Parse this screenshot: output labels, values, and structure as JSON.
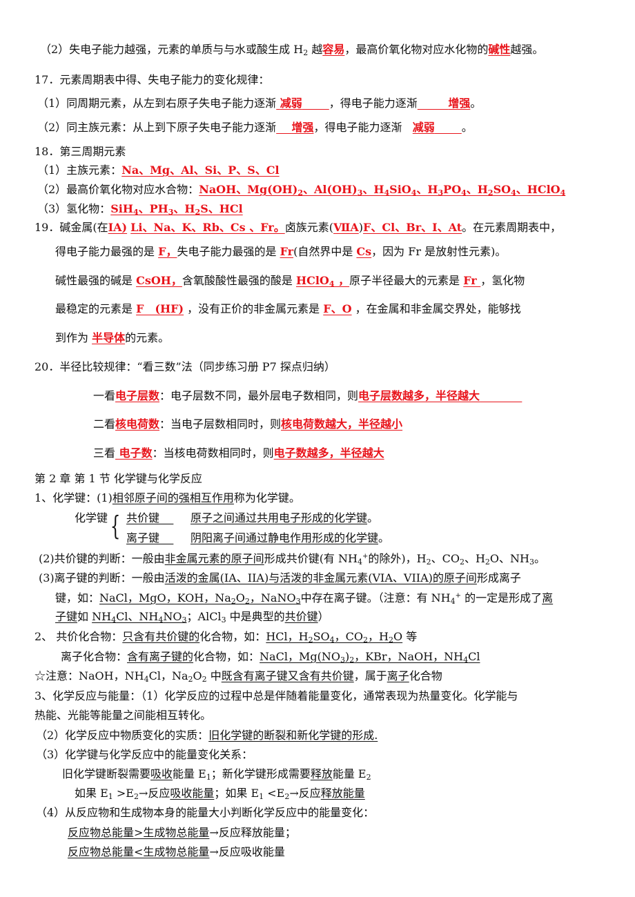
{
  "doc": {
    "l1": {
      "a": "（2）失电子能力越强，元素的单质与与水或酸生成 H",
      "sub": "2",
      "b": " 越",
      "r1": "容易",
      "c": "，最高价氧化物对应水化物的",
      "r2": "碱性",
      "d": "越强。"
    },
    "l2": "17．元素周期表中得、失电子能力的变化规律：",
    "l3": {
      "a": "（1）同周期元素，从左到右原子失电子能力逐渐",
      "r1": "减弱",
      "b": "，得电子能力逐渐",
      "r2": "增强",
      "c": "。"
    },
    "l4": {
      "a": "（2）同主族元素：从上到下原子失电子能力逐渐",
      "r1": "增强",
      "b": "，得电子能力逐渐",
      "r2": "减弱",
      "c": "。"
    },
    "l5": "18．第三周期元素",
    "l6": {
      "a": "（1）主族元素：",
      "r": "Na、Mg、Al、Si、P、S、Cl"
    },
    "l7": {
      "a": "（2）最高价氧化物对应水合物：",
      "parts": [
        "NaOH、Mg(OH)",
        "2",
        "、Al(OH)",
        "3",
        "、H",
        "4",
        "SiO",
        "4",
        "、H",
        "3",
        "PO",
        "4",
        "、H",
        "2",
        "SO",
        "4",
        "、HClO",
        "4"
      ]
    },
    "l8": {
      "a": "（3）氢化物：",
      "parts": [
        "SiH",
        "4",
        "、PH",
        "3",
        "、H",
        "2",
        "S、HCl"
      ]
    },
    "l9": {
      "a": "19．碱金属(在",
      "r1": "ⅠA)",
      "r2": "Li、Na、K、Rb、Cs 、Fr。",
      "b": "卤族元素(",
      "r3": "ⅦA",
      "c": ")",
      "r4": "F、Cl、Br、I、At",
      "d": "。在元素周期表中，"
    },
    "l10": {
      "a": "得电子能力最强的是 ",
      "r1": "F，",
      "b": "失电子能力最强的是 ",
      "r2": "Fr",
      "c": "(自然界中是 ",
      "r3": "Cs",
      "d": "，因为 Fr 是放射性元素)。"
    },
    "l11": {
      "a": "碱性最强的碱是 ",
      "r1": "CsOH，",
      "b": "含氧酸酸性最强的酸是 ",
      "r2": "HClO",
      "r2sub": "4",
      "r2b": " ，",
      "c": "原子半径最大的元素是 ",
      "r3": "Fr ",
      "d": "，氢化物"
    },
    "l12": {
      "a": "最稳定的元素是 ",
      "r1": "F　(HF)",
      "b": " ，没有正价的非金属元素是 ",
      "r2": "F、O",
      "c": " ，在金属和非金属交界处，能够找"
    },
    "l13": {
      "a": "到作为 ",
      "r1": "半导体",
      "b": "的元素。"
    },
    "l14": "20．半径比较规律：“看三数”法（同步练习册 P7  探点归纳）",
    "l15": {
      "a": "一看",
      "r1": "电子层数",
      "b": "：电子层数不同，最外层电子数相同，则",
      "r2": "电子层数越多，半径越大"
    },
    "l16": {
      "a": "二看",
      "r1": "核电荷数",
      "b": "：当电子层数相同时，则",
      "r2": "核电荷数越大，半径越小"
    },
    "l17": {
      "a": "三看",
      "r1": "电子数",
      "b": "：当核电荷数相同时，则",
      "r2": "电子数越多，半径越大"
    },
    "l18": "第 2 章  第 1 节  化学键与化学反应",
    "l19": {
      "a": "1、化学键：(1)",
      "u": "相邻原子间的强相互作用",
      "b": "称为化学键。"
    },
    "l20": {
      "label": "化学键",
      "k1": "共价键",
      "d1": "原子之间通过共用电子形成的化学键",
      "e": "。"
    },
    "l21": {
      "k2": "离子键",
      "d2": "阴阳离子间通过静电作用形成的化学键",
      "e": "。"
    },
    "l22": {
      "a": "(2)共价键的判断：一般由",
      "u": "非金属元素的原子间",
      "b": "形成共价键(有 NH",
      "sub": "4",
      "sup": "+",
      "c": "的除外)，H",
      "s2": "2",
      "d": "、CO",
      "s3": "2",
      "e": "、H",
      "s4": "2",
      "f": "O、NH",
      "s5": "3",
      "g": "。"
    },
    "l23": {
      "a": "(3)离子键的判断：一般由",
      "u": "活泼的金属(IA、IIA)与活泼的非金属元素(VIA、VIIA)的原子间",
      "b": "形成离子"
    },
    "l24": {
      "a": "键，如：",
      "u1": "NaCl，MgO，KOH，Na",
      "s1": "2",
      "u1b": "O",
      "s2": "2",
      "u1c": "，NaNO",
      "s3": "3",
      "b": "中存在离子键。（注意：有 NH",
      "s4": "4",
      "sup": "+",
      "c": " 的一定是形成了",
      "u2": "离"
    },
    "l25": {
      "u1": "子键",
      "a": "如 ",
      "u2": "NH",
      "s1": "4",
      "u2b": "Cl、NH",
      "s2": "4",
      "u2c": "NO",
      "s3": "3",
      "b": "；AlCl",
      "s4": "3",
      "c": " 中是典型的",
      "u3": "共价键",
      "d": "）"
    },
    "l26": {
      "a": "2、  共价化合物：",
      "u1": "只含有共价键的",
      "b": "化合物，如：",
      "u2": "HCl，H",
      "s1": "2",
      "u2b": "SO",
      "s2": "4",
      "u2c": "，CO",
      "s3": "2",
      "u2d": "，H",
      "s4": "2",
      "u2e": "O",
      "c": " 等"
    },
    "l27": {
      "a": "离子化合物：",
      "u1": "含有离子键的",
      "b": "化合物，如：",
      "u2": "NaCl，Mg(NO",
      "s1": "3",
      "u2b": ")",
      "s2": "2",
      "u2c": "，KBr，NaOH，NH",
      "s3": "4",
      "u2d": "Cl"
    },
    "l28": {
      "a": "☆注意：NaOH，NH",
      "s1": "4",
      "b": "Cl，Na",
      "s2": "2",
      "c": "O",
      "s3": "2",
      "d": " 中",
      "u1": "既含有离子键又含有共价键",
      "e": "，属于",
      "u2": "离子",
      "f": "化合物"
    },
    "l29": "3、化学反应与能量：（1）化学反应的过程中总是伴随着能量变化，通常表现为热量变化。化学能与",
    "l30": "热能、光能等能量之间能相互转化。",
    "l31": {
      "a": "（2）化学反应中物质变化的实质：",
      "u": "旧化学键的断裂和新化学键的形成."
    },
    "l32": "（3）化学键与化学反应中的能量变化关系：",
    "l33": {
      "a": "旧化学键断裂需要",
      "u1": "吸收",
      "b": "能量 E",
      "s1": "1",
      "c": "；新化学键形成需要",
      "u2": "释放",
      "d": "能量 E",
      "s2": "2"
    },
    "l34": {
      "a": "如果 E",
      "s1": "1",
      "b": " >E",
      "s2": "2",
      "c": "→反应",
      "u1": "吸收能量",
      "d": "；如果 E",
      "s3": "1",
      "e": " <E",
      "s4": "2",
      "f": "→反应",
      "u2": "释放能量"
    },
    "l35": "（4）从反应物和生成物本身的能量大小判断化学反应中的能量变化：",
    "l36": {
      "u": "反应物总能量>生成物总能量",
      "a": "→反应释放能量；"
    },
    "l37": {
      "u": "反应物总能量<生成物总能量",
      "a": "→反应吸收能量"
    }
  }
}
